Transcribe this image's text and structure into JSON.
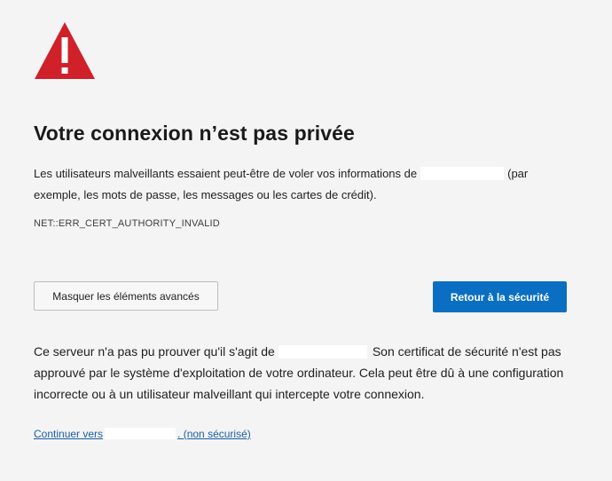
{
  "page": {
    "title": "Votre connexion n’est pas privée",
    "summary_part1": "Les utilisateurs malveillants essaient peut-être de voler vos informations de",
    "summary_part2": "(par exemple, les mots de passe, les messages ou les cartes de crédit).",
    "error_code": "NET::ERR_CERT_AUTHORITY_INVALID"
  },
  "buttons": {
    "advanced_label": "Masquer les éléments avancés",
    "safety_label": "Retour à la sécurité"
  },
  "details": {
    "part1": "Ce serveur n'a pas pu prouver qu'il s'agit de",
    "part2": "Son certificat de sécurité n'est pas approuvé par le système d'exploitation de votre ordinateur. Cela peut être dû à une configuration incorrecte ou à un utilisateur malveillant qui intercepte votre connexion."
  },
  "link": {
    "prefix": "Continuer vers",
    "suffix": ". (non sécurisé)"
  },
  "icons": {
    "warning": "warning-triangle-icon"
  },
  "colors": {
    "warning_red": "#d0202a",
    "primary_blue": "#0a6fc2",
    "link_blue": "#1a5fa6"
  }
}
